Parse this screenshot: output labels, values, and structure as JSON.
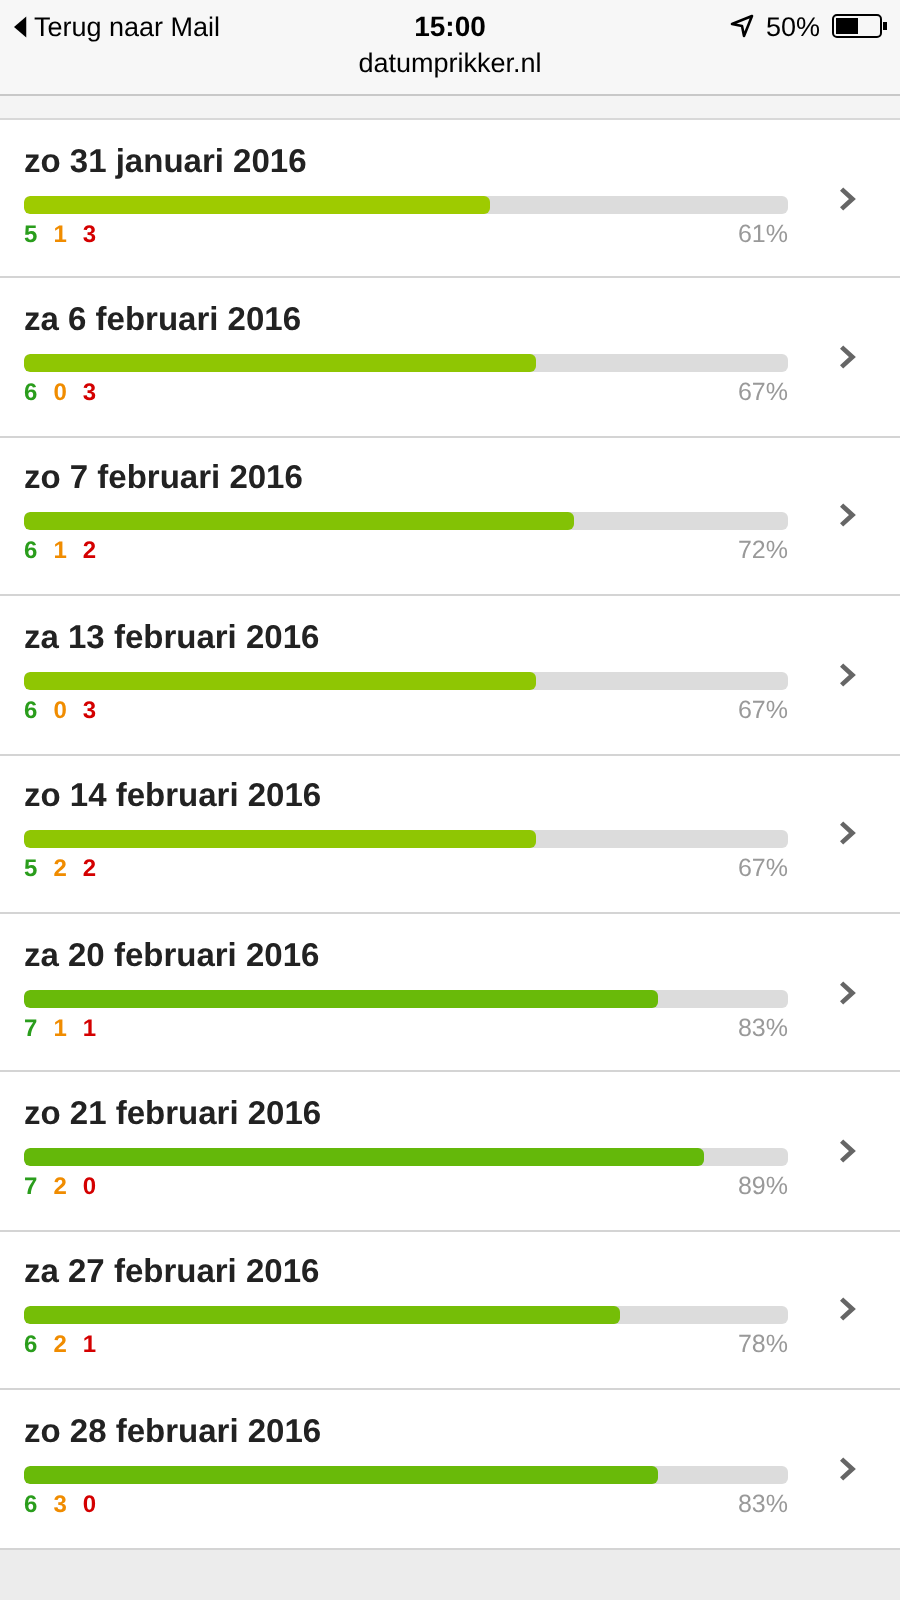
{
  "status_bar": {
    "back": "Terug naar Mail",
    "time": "15:00",
    "battery": "50%",
    "url": "datumprikker.nl"
  },
  "dates": [
    {
      "date": "zo 31 januari 2016",
      "level": 0.61,
      "yes": "5",
      "maybe": "1",
      "no": "3",
      "percent": "61%"
    },
    {
      "date": "za 6 februari 2016",
      "level": 0.67,
      "yes": "6",
      "maybe": "0",
      "no": "3",
      "percent": "67%"
    },
    {
      "date": "zo 7 februari 2016",
      "level": 0.72,
      "yes": "6",
      "maybe": "1",
      "no": "2",
      "percent": "72%"
    },
    {
      "date": "za 13 februari 2016",
      "level": 0.67,
      "yes": "6",
      "maybe": "0",
      "no": "3",
      "percent": "67%"
    },
    {
      "date": "zo 14 februari 2016",
      "level": 0.67,
      "yes": "5",
      "maybe": "2",
      "no": "2",
      "percent": "67%"
    },
    {
      "date": "za 20 februari 2016",
      "level": 0.83,
      "yes": "7",
      "maybe": "1",
      "no": "1",
      "percent": "83%"
    },
    {
      "date": "zo 21 februari 2016",
      "level": 0.89,
      "yes": "7",
      "maybe": "2",
      "no": "0",
      "percent": "89%"
    },
    {
      "date": "za 27 februari 2016",
      "level": 0.78,
      "yes": "6",
      "maybe": "2",
      "no": "1",
      "percent": "78%"
    },
    {
      "date": "zo 28 februari 2016",
      "level": 0.83,
      "yes": "6",
      "maybe": "3",
      "no": "0",
      "percent": "83%"
    }
  ]
}
